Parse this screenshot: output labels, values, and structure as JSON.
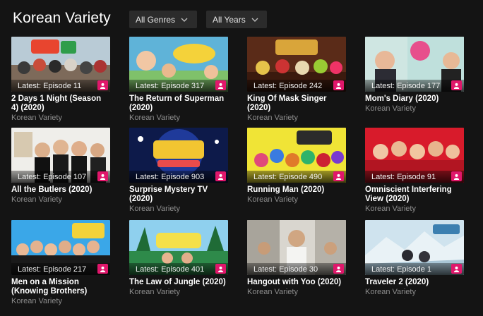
{
  "header": {
    "title": "Korean Variety"
  },
  "filters": {
    "genres": {
      "label": "All Genres",
      "icon": "chevron-down-icon"
    },
    "years": {
      "label": "All Years",
      "icon": "chevron-down-icon"
    }
  },
  "badge_icon": "person-icon",
  "accent_color": "#e0176b",
  "cards": [
    {
      "title": "2 Days 1 Night (Season 4) (2020)",
      "episode": "Latest: Episode 11",
      "category": "Korean Variety"
    },
    {
      "title": "The Return of Superman (2020)",
      "episode": "Latest: Episode 317",
      "category": "Korean Variety"
    },
    {
      "title": "King Of Mask Singer (2020)",
      "episode": "Latest: Episode 242",
      "category": "Korean Variety"
    },
    {
      "title": "Mom's Diary (2020)",
      "episode": "Latest: Episode 177",
      "category": "Korean Variety"
    },
    {
      "title": "All the Butlers (2020)",
      "episode": "Latest: Episode 107",
      "category": "Korean Variety"
    },
    {
      "title": "Surprise Mystery TV (2020)",
      "episode": "Latest: Episode 903",
      "category": "Korean Variety"
    },
    {
      "title": "Running Man (2020)",
      "episode": "Latest: Episode 490",
      "category": "Korean Variety"
    },
    {
      "title": "Omniscient Interfering View (2020)",
      "episode": "Latest: Episode 91",
      "category": "Korean Variety"
    },
    {
      "title": "Men on a Mission (Knowing Brothers) (202...",
      "episode": "Latest: Episode 217",
      "category": "Korean Variety"
    },
    {
      "title": "The Law of Jungle (2020)",
      "episode": "Latest: Episode 401",
      "category": "Korean Variety"
    },
    {
      "title": "Hangout with Yoo (2020)",
      "episode": "Latest: Episode 30",
      "category": "Korean Variety"
    },
    {
      "title": "Traveler 2 (2020)",
      "episode": "Latest: Episode 1",
      "category": "Korean Variety"
    }
  ]
}
